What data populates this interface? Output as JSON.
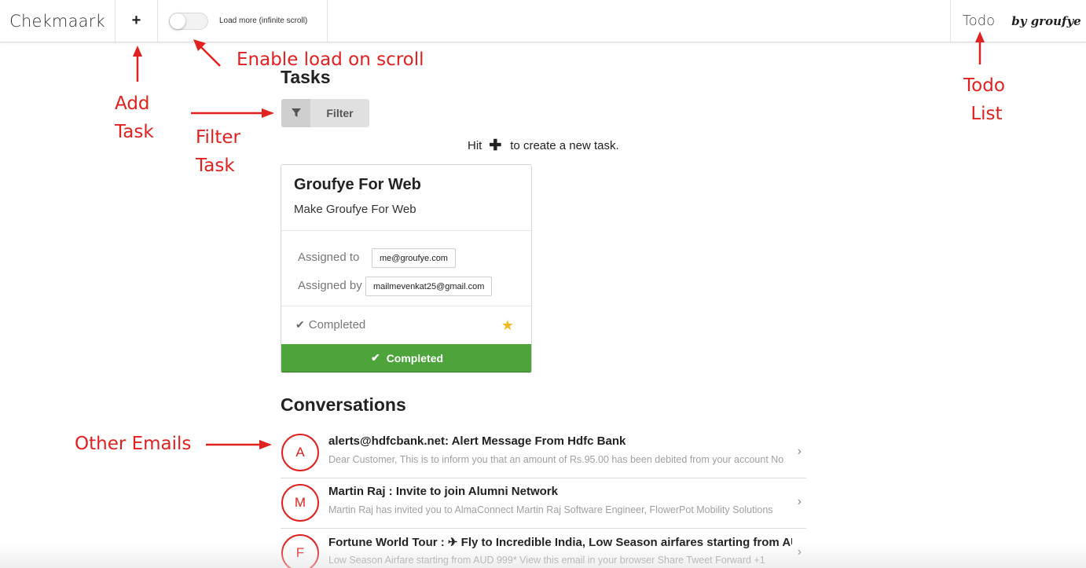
{
  "header": {
    "brand": "Chekmaark",
    "add_label": "+",
    "scroll_toggle_label": "Load more (infinite scroll)",
    "scroll_toggle_on": false,
    "todo_label": "Todo",
    "byline": "by groufye"
  },
  "annotations": {
    "add_task": [
      "Add",
      "Task"
    ],
    "enable_scroll": "Enable load on scroll",
    "filter_task": [
      "Filter",
      "Task"
    ],
    "todo_list": [
      "Todo",
      "List"
    ],
    "other_emails": "Other Emails",
    "color": "#e0211f"
  },
  "tasks": {
    "title": "Tasks",
    "filter_label": "Filter",
    "hint_prefix": "Hit",
    "hint_plus": "✚",
    "hint_suffix": "to create a new task.",
    "card": {
      "title": "Groufye For Web",
      "description": "Make Groufye For Web",
      "assigned_to_label": "Assigned to",
      "assigned_to": "me@groufye.com",
      "assigned_by_label": "Assigned by",
      "assigned_by": "mailmevenkat25@gmail.com",
      "status": "Completed",
      "starred": true,
      "action_label": "Completed",
      "action_color": "#4ca43a"
    }
  },
  "conversations": {
    "title": "Conversations",
    "items": [
      {
        "initial": "A",
        "subject": "alerts@hdfcbank.net: Alert Message From Hdfc Bank",
        "preview": "Dear Customer, This is to inform you that an amount of Rs.95.00 has been debited from your account No"
      },
      {
        "initial": "M",
        "subject": "Martin Raj : Invite to join Alumni Network",
        "preview": "Martin Raj has invited you to AlmaConnect Martin Raj Software Engineer, FlowerPot Mobility Solutions"
      },
      {
        "initial": "F",
        "subject": "Fortune World Tour : ✈ Fly to Incredible India, Low Season airfares starting from AUD",
        "preview": "Low Season Airfare starting from AUD 999* View this email in your browser Share Tweet Forward +1"
      }
    ]
  }
}
